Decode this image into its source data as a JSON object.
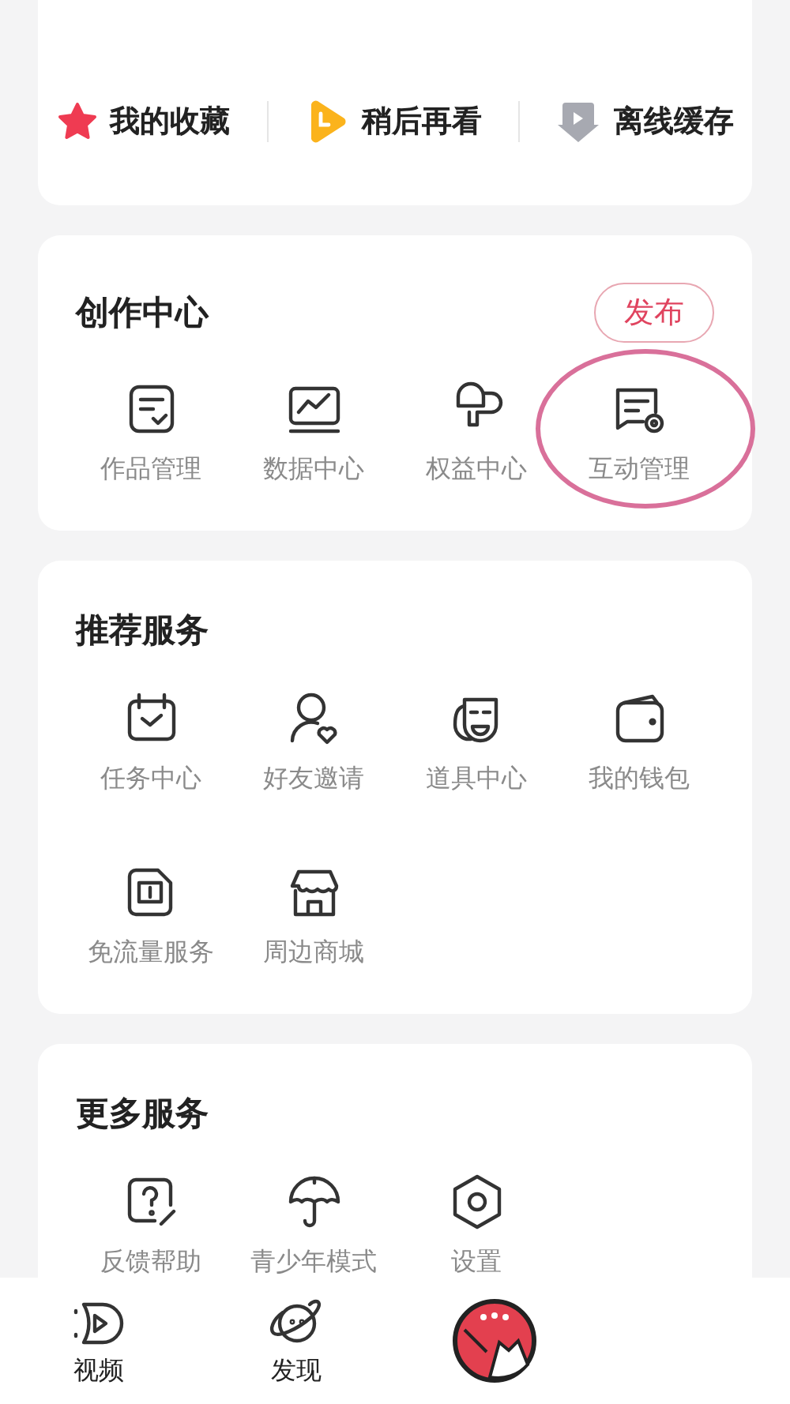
{
  "quick_links": [
    {
      "label": "我的收藏"
    },
    {
      "label": "稍后再看"
    },
    {
      "label": "离线缓存"
    }
  ],
  "sections": [
    {
      "title": "创作中心",
      "action": "发布",
      "items": [
        {
          "label": "作品管理",
          "circled": false
        },
        {
          "label": "数据中心",
          "circled": false
        },
        {
          "label": "权益中心",
          "circled": false
        },
        {
          "label": "互动管理",
          "circled": true
        }
      ]
    },
    {
      "title": "推荐服务",
      "items": [
        {
          "label": "任务中心",
          "circled": false
        },
        {
          "label": "好友邀请",
          "circled": false
        },
        {
          "label": "道具中心",
          "circled": false
        },
        {
          "label": "我的钱包",
          "circled": false
        },
        {
          "label": "免流量服务",
          "circled": false
        },
        {
          "label": "周边商城",
          "circled": false
        }
      ]
    },
    {
      "title": "更多服务",
      "items": [
        {
          "label": "反馈帮助",
          "circled": false
        },
        {
          "label": "青少年模式",
          "circled": false
        },
        {
          "label": "设置",
          "circled": false
        }
      ]
    }
  ],
  "tab_bar": [
    {
      "label": "视频",
      "kind": "tab"
    },
    {
      "label": "发现",
      "kind": "tab"
    },
    {
      "kind": "avatar"
    }
  ]
}
